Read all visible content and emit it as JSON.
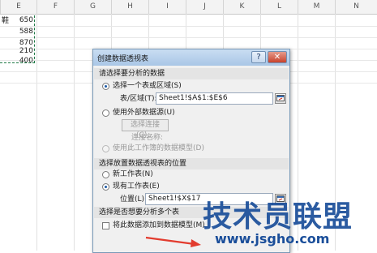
{
  "sheet": {
    "columns": [
      "E",
      "F",
      "G",
      "H",
      "I",
      "J",
      "K",
      "L",
      "M",
      "N"
    ],
    "header_cell": "鞋",
    "values": [
      "650",
      "588",
      "870",
      "210",
      "400"
    ]
  },
  "dialog": {
    "title": "创建数据透视表",
    "help_symbol": "?",
    "close_symbol": "✕",
    "section1": {
      "header": "请选择要分析的数据",
      "option_table": "选择一个表或区域(S)",
      "range_label": "表/区域(T):",
      "range_value": "Sheet1!$A$1:$E$6",
      "option_external": "使用外部数据源(U)",
      "choose_connection": "选择连接(C)...",
      "connection_name_label": "连接名称:",
      "option_data_model": "使用此工作簿的数据模型(D)"
    },
    "section2": {
      "header": "选择放置数据透视表的位置",
      "option_new_sheet": "新工作表(N)",
      "option_existing_sheet": "现有工作表(E)",
      "location_label": "位置(L):",
      "location_value": "Sheet1!$X$17"
    },
    "section3": {
      "header": "选择是否想要分析多个表",
      "add_to_model": "将此数据添加到数据模型(M)"
    }
  },
  "watermark": {
    "chinese": "技术员联盟",
    "url": "www.jsgho.com"
  },
  "colors": {
    "watermark": "#1a4e9a",
    "arrow": "#e23b2e",
    "selection": "#1e7a46"
  }
}
